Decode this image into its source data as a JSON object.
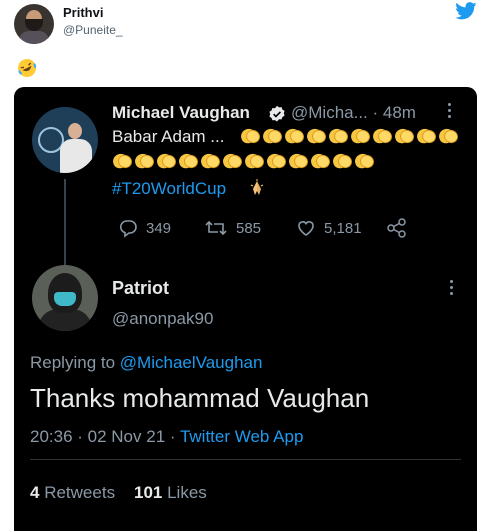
{
  "outer": {
    "name": "Prithvi",
    "handle": "@Puneite_",
    "emoji": "rolling-on-floor-laughing",
    "bird_color": "#1d9bf0"
  },
  "tweet": {
    "name": "Michael Vaughan",
    "handle": "@Micha...",
    "time": "· 48m",
    "text": "Babar Adam ...",
    "hashtag": "#T20WorldCup",
    "replies": "349",
    "retweets": "585",
    "likes": "5,181"
  },
  "reply": {
    "name": "Patriot",
    "handle": "@anonpak90",
    "replying_label": "Replying to",
    "replying_mention": "@MichaelVaughan",
    "text": "Thanks mohammad Vaughan",
    "time": "20:36 · 02 Nov 21 ·",
    "app": "Twitter Web App",
    "retweets_count": "4",
    "retweets_label": "Retweets",
    "likes_count": "101",
    "likes_label": "Likes"
  },
  "colors": {
    "accent": "#1d9bf0",
    "background_dark": "#000000",
    "secondary_text": "#8b98a5"
  }
}
